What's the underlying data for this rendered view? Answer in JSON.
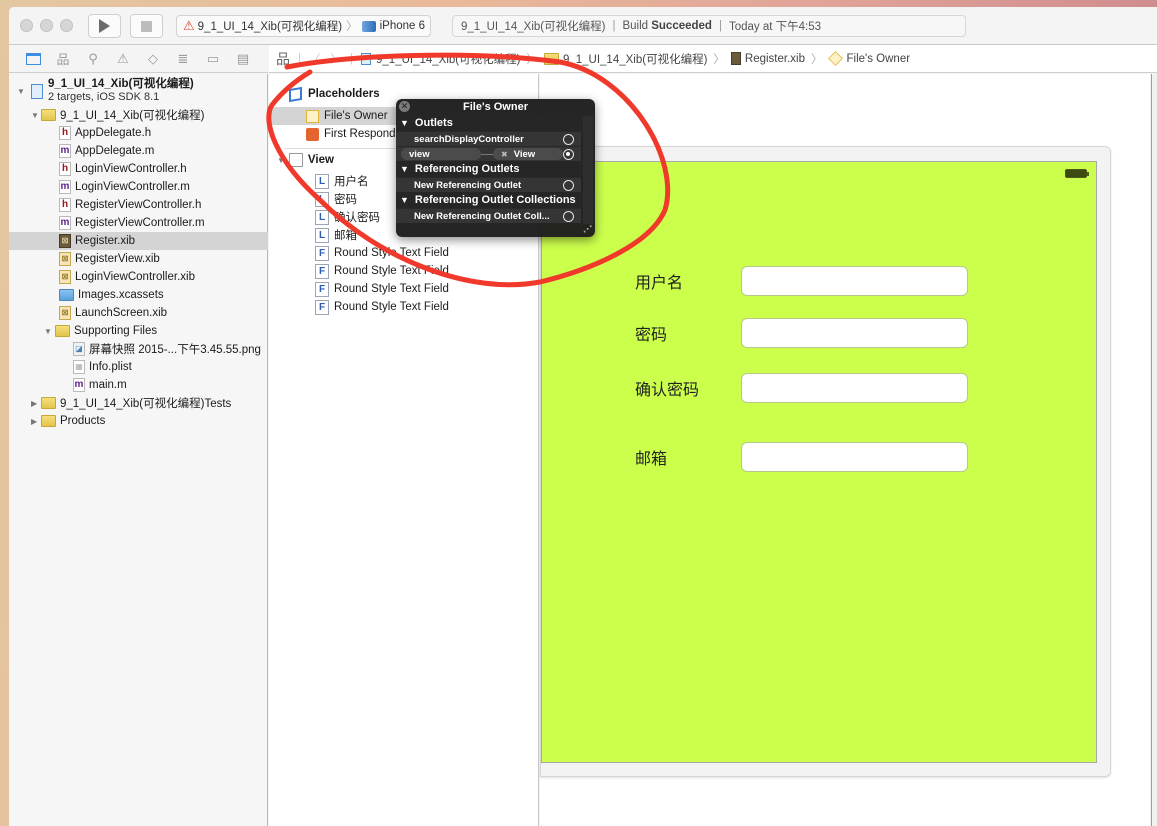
{
  "toolbar": {
    "scheme_name": "9_1_UI_14_Xib(可视化编程)",
    "device": "iPhone 6",
    "status_project": "9_1_UI_14_Xib(可视化编程)",
    "status_build_prefix": "Build",
    "status_build_result": "Succeeded",
    "status_time": "Today at 下午4:53"
  },
  "navigator_tabs": [
    "project-navigator",
    "symbol-navigator",
    "find-navigator",
    "issue-navigator",
    "test-navigator",
    "debug-navigator",
    "breakpoint-navigator",
    "report-navigator"
  ],
  "project": {
    "name": "9_1_UI_14_Xib(可视化编程)",
    "subtitle": "2 targets, iOS SDK 8.1",
    "group_name": "9_1_UI_14_Xib(可视化编程)",
    "files": [
      {
        "name": "AppDelegate.h",
        "type": "h"
      },
      {
        "name": "AppDelegate.m",
        "type": "m"
      },
      {
        "name": "LoginViewController.h",
        "type": "h"
      },
      {
        "name": "LoginViewController.m",
        "type": "m"
      },
      {
        "name": "RegisterViewController.h",
        "type": "h"
      },
      {
        "name": "RegisterViewController.m",
        "type": "m"
      },
      {
        "name": "Register.xib",
        "type": "xib",
        "selected": true
      },
      {
        "name": "RegisterView.xib",
        "type": "xib"
      },
      {
        "name": "LoginViewController.xib",
        "type": "xib"
      },
      {
        "name": "Images.xcassets",
        "type": "xcassets"
      },
      {
        "name": "LaunchScreen.xib",
        "type": "xib"
      }
    ],
    "supporting_files": {
      "name": "Supporting Files",
      "files": [
        {
          "name": "屏幕快照 2015-...下午3.45.55.png",
          "type": "png"
        },
        {
          "name": "Info.plist",
          "type": "plist"
        },
        {
          "name": "main.m",
          "type": "m"
        }
      ]
    },
    "tests_group": "9_1_UI_14_Xib(可视化编程)Tests",
    "products_group": "Products"
  },
  "jumpbar": {
    "crumbs": [
      "9_1_UI_14_Xib(可视化编程)",
      "9_1_UI_14_Xib(可视化编程)",
      "Register.xib",
      "File's Owner"
    ]
  },
  "outline": {
    "placeholders_label": "Placeholders",
    "files_owner": "File's Owner",
    "first_responder": "First Responder",
    "view_label": "View",
    "children": [
      {
        "badge": "L",
        "name": "用户名"
      },
      {
        "badge": "L",
        "name": "密码"
      },
      {
        "badge": "L",
        "name": "确认密码"
      },
      {
        "badge": "L",
        "name": "邮箱"
      },
      {
        "badge": "F",
        "name": "Round Style Text Field"
      },
      {
        "badge": "F",
        "name": "Round Style Text Field"
      },
      {
        "badge": "F",
        "name": "Round Style Text Field"
      },
      {
        "badge": "F",
        "name": "Round Style Text Field"
      }
    ]
  },
  "popup": {
    "title": "File's Owner",
    "outlets_header": "Outlets",
    "outlets": [
      {
        "name": "searchDisplayController",
        "connected": false
      },
      {
        "name": "view",
        "target": "View",
        "connected": true
      }
    ],
    "ref_outlets_header": "Referencing Outlets",
    "ref_outlets": [
      {
        "name": "New Referencing Outlet",
        "connected": false
      }
    ],
    "ref_collections_header": "Referencing Outlet Collections",
    "ref_collections": [
      {
        "name": "New Referencing Outlet Coll...",
        "connected": false
      }
    ]
  },
  "scene": {
    "background_color": "#ccff4c",
    "fields": [
      {
        "label": "用户名",
        "value": ""
      },
      {
        "label": "密码",
        "value": ""
      },
      {
        "label": "确认密码",
        "value": ""
      },
      {
        "label": "邮箱",
        "value": ""
      }
    ]
  },
  "annotation_color": "#f0392b"
}
